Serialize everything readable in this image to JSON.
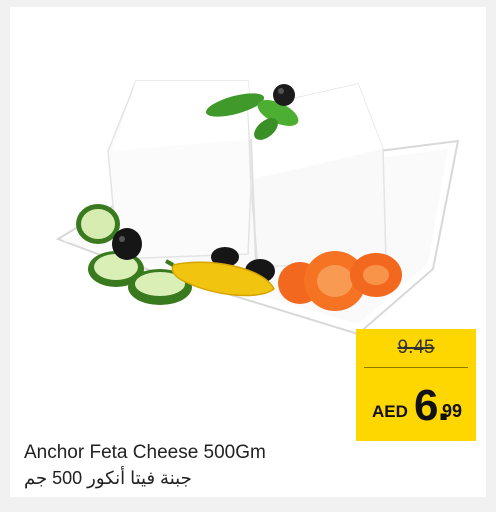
{
  "product": {
    "name_en": "Anchor Feta Cheese 500Gm",
    "name_ar": "جبنة فيتا أنكور 500 جم"
  },
  "price": {
    "old": "9.45",
    "currency": "AED",
    "main": "6.",
    "decimal": "99"
  },
  "colors": {
    "tag": "#ffd700",
    "text": "#222222"
  }
}
